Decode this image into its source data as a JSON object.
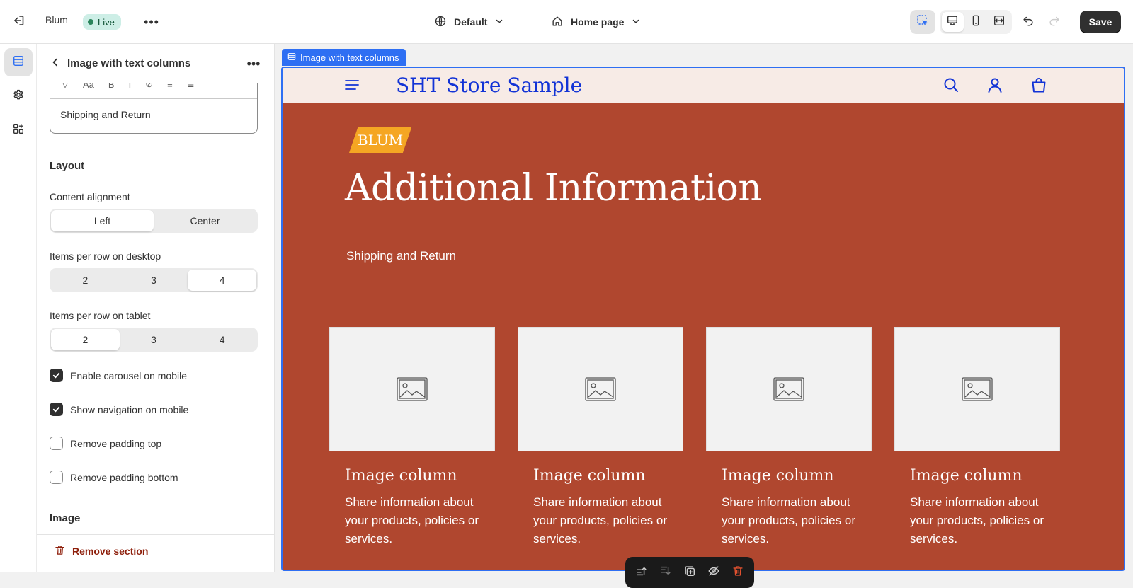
{
  "topbar": {
    "store_name": "Blum",
    "status": "Live",
    "theme": "Default",
    "page": "Home page",
    "save_label": "Save",
    "icons": [
      "exit-icon",
      "globe-icon",
      "chevron-down-icon",
      "home-icon",
      "inspector-icon",
      "desktop-icon",
      "mobile-icon",
      "fullwidth-icon",
      "undo-icon",
      "redo-icon"
    ],
    "colors": {
      "live_badge_bg": "#cdeee6",
      "save_bg": "#303030"
    }
  },
  "rail": {
    "items": [
      {
        "name": "sections",
        "icon": "sections-icon",
        "active": true
      },
      {
        "name": "theme-settings",
        "icon": "gear-icon",
        "active": false
      },
      {
        "name": "apps",
        "icon": "apps-icon",
        "active": false
      }
    ]
  },
  "panel": {
    "title": "Image with text columns",
    "editor_text": "Shipping and Return",
    "layout_heading": "Layout",
    "alignment_label": "Content alignment",
    "alignment_options": [
      "Left",
      "Center"
    ],
    "alignment_selected": "Left",
    "desktop_label": "Items per row on desktop",
    "desktop_options": [
      "2",
      "3",
      "4"
    ],
    "desktop_selected": "4",
    "tablet_label": "Items per row on tablet",
    "tablet_options": [
      "2",
      "3",
      "4"
    ],
    "tablet_selected": "2",
    "checkboxes": [
      {
        "label": "Enable carousel on mobile",
        "checked": true
      },
      {
        "label": "Show navigation on mobile",
        "checked": true
      },
      {
        "label": "Remove padding top",
        "checked": false
      },
      {
        "label": "Remove padding bottom",
        "checked": false
      }
    ],
    "image_heading": "Image",
    "remove_label": "Remove section"
  },
  "preview": {
    "selection_tag": "Image with text columns",
    "store_logo": "SHT Store Sample",
    "badge": "BLUM",
    "heading": "Additional Information",
    "subheading": "Shipping and Return",
    "columns": [
      {
        "title": "Image column",
        "text": "Share information about your products, policies or services."
      },
      {
        "title": "Image column",
        "text": "Share information about your products, policies or services."
      },
      {
        "title": "Image column",
        "text": "Share information about your products, policies or services."
      },
      {
        "title": "Image column",
        "text": "Share information about your products, policies or services."
      }
    ],
    "colors": {
      "section_bg": "#b0472f",
      "header_bg": "#f7ebe6",
      "logo": "#1233d6",
      "badge_bg": "#f5a623",
      "selection": "#2e6ff3"
    },
    "floating_toolbar_icons": [
      "move-up-icon",
      "move-down-icon",
      "duplicate-icon",
      "hide-icon",
      "delete-icon"
    ]
  }
}
